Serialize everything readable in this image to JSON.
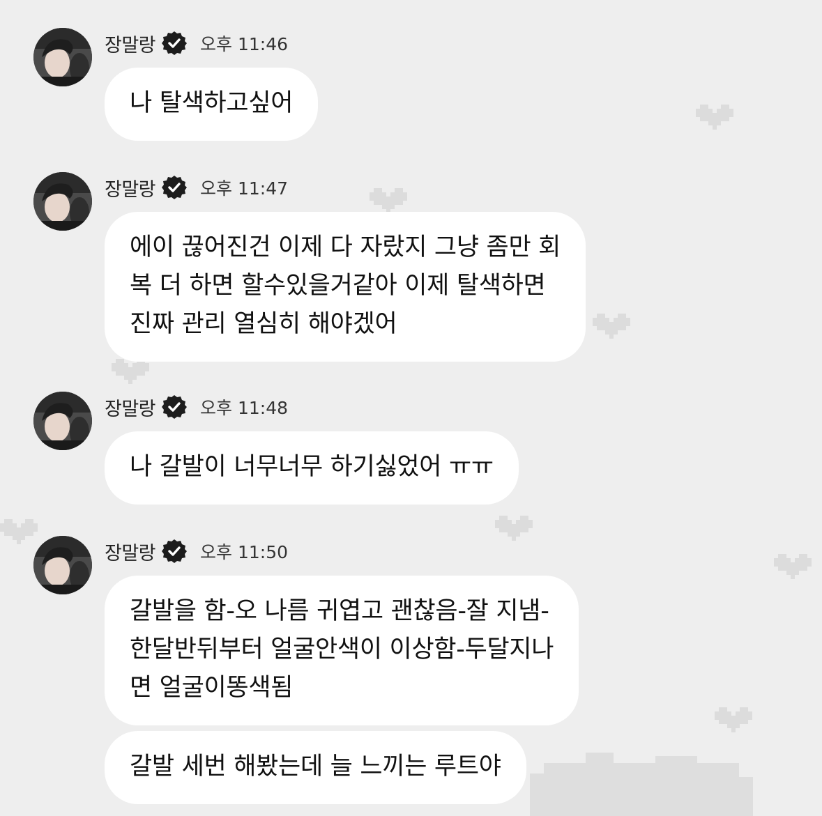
{
  "chat": {
    "messages": [
      {
        "sender": "장말랑",
        "time": "오후 11:46",
        "bubbles": [
          {
            "lines": [
              "나 탈색하고싶어"
            ]
          }
        ]
      },
      {
        "sender": "장말랑",
        "time": "오후 11:47",
        "bubbles": [
          {
            "lines": [
              "에이 끊어진건 이제 다 자랐지 그냥 좀만 회",
              "복 더 하면 할수있을거같아 이제 탈색하면",
              "진짜 관리 열심히 해야겠어"
            ]
          }
        ]
      },
      {
        "sender": "장말랑",
        "time": "오후 11:48",
        "bubbles": [
          {
            "lines": [
              "나 갈발이 너무너무 하기싫었어 ㅠㅠ"
            ]
          }
        ]
      },
      {
        "sender": "장말랑",
        "time": "오후 11:50",
        "bubbles": [
          {
            "lines": [
              "갈발을 함-오 나름 귀엽고 괜찮음-잘 지냄-",
              "한달반뒤부터 얼굴안색이 이상함-두달지나",
              "면 얼굴이똥색됨"
            ]
          },
          {
            "lines": [
              "갈발 세번 해봤는데 늘 느끼는 루트야"
            ]
          }
        ]
      }
    ]
  },
  "theme": {
    "background": "#eeeeee",
    "bubble": "#ffffff",
    "decor": "#d9d9d9",
    "icons": {
      "verified": "verified-badge-icon",
      "background": "pixel-heart-icon"
    }
  }
}
